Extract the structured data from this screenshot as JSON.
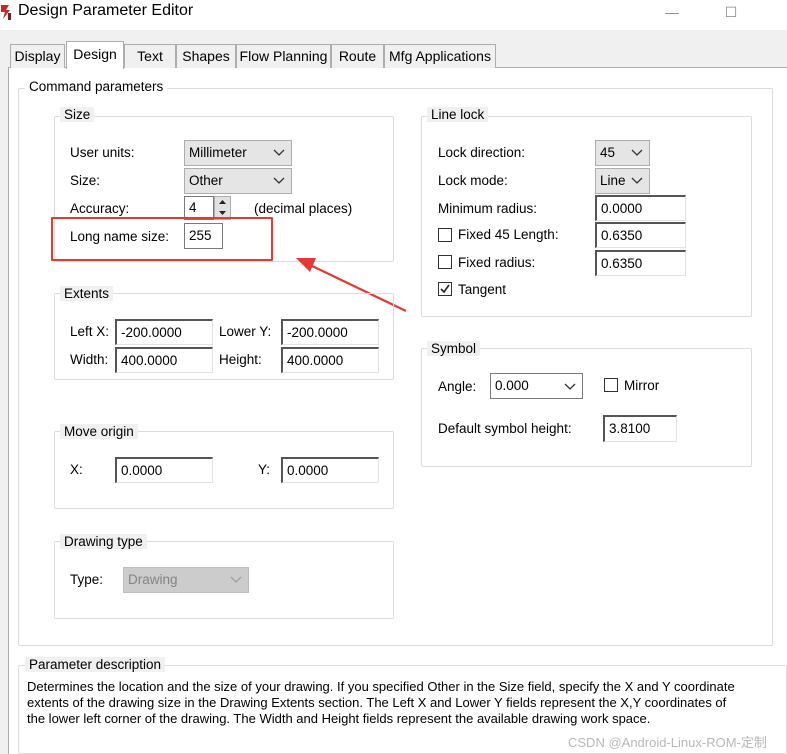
{
  "window": {
    "title": "Design Parameter Editor",
    "minimize": "—",
    "maximize": "☐"
  },
  "tabs": [
    "Display",
    "Design",
    "Text",
    "Shapes",
    "Flow Planning",
    "Route",
    "Mfg Applications"
  ],
  "command_parameters": {
    "label": "Command parameters",
    "size": {
      "label": "Size",
      "user_units_label": "User units:",
      "user_units_value": "Millimeter",
      "size_label": "Size:",
      "size_value": "Other",
      "accuracy_label": "Accuracy:",
      "accuracy_value": "4",
      "accuracy_suffix": "(decimal places)",
      "long_name_label": "Long name size:",
      "long_name_value": "255"
    },
    "extents": {
      "label": "Extents",
      "left_x_label": "Left X:",
      "left_x_value": "-200.0000",
      "lower_y_label": "Lower Y:",
      "lower_y_value": "-200.0000",
      "width_label": "Width:",
      "width_value": "400.0000",
      "height_label": "Height:",
      "height_value": "400.0000"
    },
    "move_origin": {
      "label": "Move origin",
      "x_label": "X:",
      "x_value": "0.0000",
      "y_label": "Y:",
      "y_value": "0.0000"
    },
    "drawing_type": {
      "label": "Drawing type",
      "type_label": "Type:",
      "type_value": "Drawing"
    },
    "line_lock": {
      "label": "Line lock",
      "direction_label": "Lock direction:",
      "direction_value": "45",
      "mode_label": "Lock mode:",
      "mode_value": "Line",
      "min_radius_label": "Minimum radius:",
      "min_radius_value": "0.0000",
      "fixed45_label": "Fixed 45 Length:",
      "fixed45_value": "0.6350",
      "fixed45_checked": false,
      "fixed_radius_label": "Fixed radius:",
      "fixed_radius_value": "0.6350",
      "fixed_radius_checked": false,
      "tangent_label": "Tangent",
      "tangent_checked": true
    },
    "symbol": {
      "label": "Symbol",
      "angle_label": "Angle:",
      "angle_value": "0.000",
      "mirror_label": "Mirror",
      "mirror_checked": false,
      "height_label": "Default symbol height:",
      "height_value": "3.8100"
    }
  },
  "parameter_description": {
    "label": "Parameter description",
    "lines": [
      "Determines the location and the size of your drawing.  If you specified Other in the Size field, specify the X and Y coordinate",
      "extents of the drawing size in the Drawing Extents section. The Left X and Lower Y fields represent the X,Y coordinates of",
      "the lower left corner of the drawing.  The Width and Height fields represent the available drawing work space."
    ]
  },
  "watermark": "CSDN @Android-Linux-ROM-定制",
  "colors": {
    "highlight": "#e53935",
    "app_icon": "#c62828"
  }
}
